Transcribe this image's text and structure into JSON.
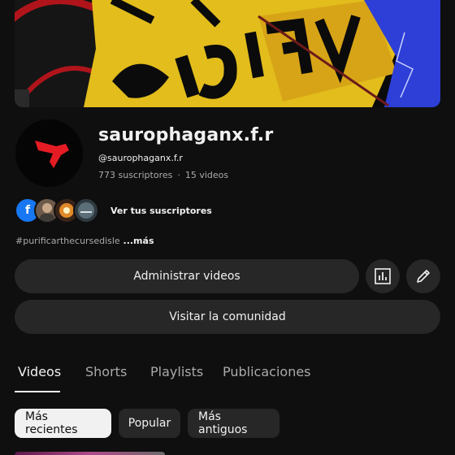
{
  "channel": {
    "name": "saurophaganx.f.r",
    "handle": "@saurophaganx.f.r",
    "subscribers": "773 suscriptores",
    "separator": "·",
    "videos": "15 videos"
  },
  "subscribers_row": {
    "avatar_icons": [
      "facebook-icon",
      "subscriber-avatar",
      "subscriber-avatar",
      "subscriber-avatar"
    ],
    "facebook_letter": "f",
    "link_label": "Ver tus suscriptores"
  },
  "description": {
    "text": "#purificarthecursedisle",
    "more_label": " ...más"
  },
  "actions": {
    "manage_label": "Administrar videos",
    "analytics_icon": "analytics-icon",
    "edit_icon": "pencil-icon",
    "community_label": "Visitar la comunidad"
  },
  "tabs": [
    {
      "label": "Videos",
      "active": true
    },
    {
      "label": "Shorts",
      "active": false
    },
    {
      "label": "Playlists",
      "active": false
    },
    {
      "label": "Publicaciones",
      "active": false
    }
  ],
  "filters": [
    {
      "label": "Más recientes",
      "active": true
    },
    {
      "label": "Popular",
      "active": false
    },
    {
      "label": "Más antiguos",
      "active": false
    }
  ],
  "colors": {
    "background": "#0f0f0f",
    "surface": "#272727",
    "text": "#f1f1f1",
    "muted": "#aaaaaa",
    "banner_yellow": "#e8c419",
    "banner_blue": "#2d3fd6",
    "logo_red": "#e51c23"
  }
}
